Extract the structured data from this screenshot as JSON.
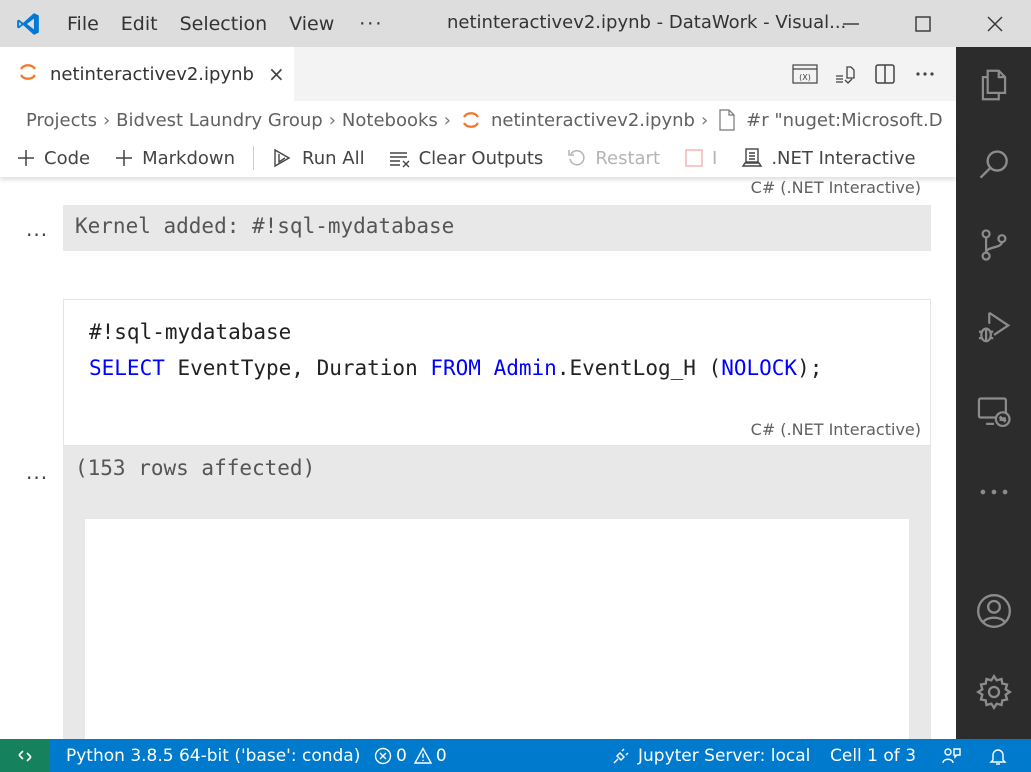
{
  "titlebar": {
    "menu": [
      "File",
      "Edit",
      "Selection",
      "View"
    ],
    "more": "···",
    "window_title": "netinteractivev2.ipynb - DataWork - Visual..."
  },
  "tab": {
    "name": "netinteractivev2.ipynb",
    "close": "×"
  },
  "breadcrumb": {
    "items": [
      "Projects",
      "Bidvest Laundry Group",
      "Notebooks",
      "netinteractivev2.ipynb",
      "#r \"nuget:Microsoft.D"
    ]
  },
  "toolbar": {
    "code": "Code",
    "markdown": "Markdown",
    "run_all": "Run All",
    "clear_outputs": "Clear Outputs",
    "restart": "Restart",
    "interrupt": "I",
    "kernel": ".NET Interactive"
  },
  "notebook": {
    "cell1_lang": "C# (.NET Interactive)",
    "cell1_output": "Kernel added: #!sql-mydatabase",
    "cell2": {
      "line1": "#!sql-mydatabase",
      "line2": {
        "kw1": "SELECT",
        "cols": " EventType, Duration ",
        "kw2": "FROM",
        "space": " ",
        "schema": "Admin",
        "rest": ".EventLog_H (",
        "hint": "NOLOCK",
        "end": ");"
      },
      "lang": "C# (.NET Interactive)"
    },
    "cell2_output": "(153 rows affected)",
    "output_ellipsis": "..."
  },
  "statusbar": {
    "python": "Python 3.8.5 64-bit ('base': conda)",
    "errors": "0",
    "warnings": "0",
    "jupyter": "Jupyter Server: local",
    "cell": "Cell 1 of 3"
  },
  "colors": {
    "accent": "#007acc",
    "remote": "#16825d",
    "keyword": "#0000ff",
    "jupyter_orange": "#f37626"
  }
}
